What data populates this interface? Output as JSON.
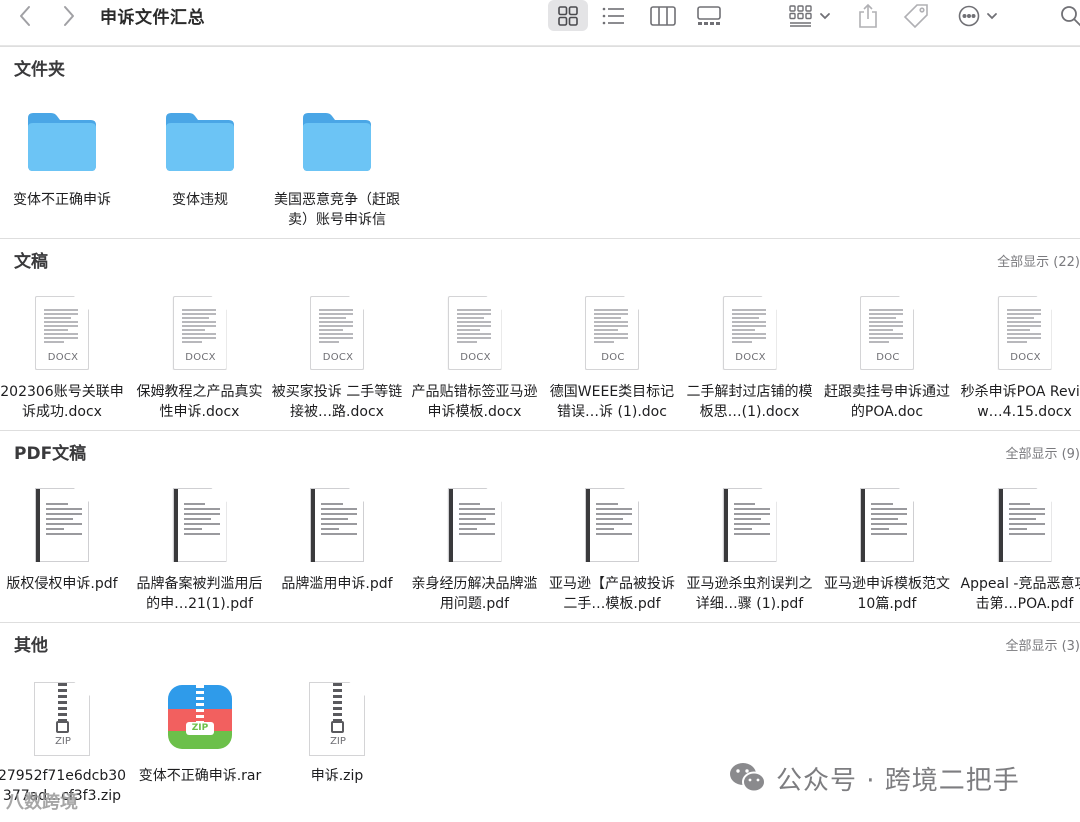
{
  "toolbar": {
    "title": "申诉文件汇总",
    "icons": [
      "chevron-left",
      "chevron-right",
      "grid-view",
      "list-view",
      "column-view",
      "gallery-view",
      "group-by",
      "share",
      "tag",
      "more",
      "search"
    ]
  },
  "sections": {
    "folders": {
      "title": "文件夹",
      "items": [
        {
          "name": "变体不正确申诉"
        },
        {
          "name": "变体违规"
        },
        {
          "name": "美国恶意竞争（赶跟卖）账号申诉信"
        }
      ]
    },
    "documents": {
      "title": "文稿",
      "show_all": "全部显示 (22)",
      "items": [
        {
          "name": "202306账号关联申诉成功.docx",
          "type": "DOCX"
        },
        {
          "name": "保姆教程之产品真实性申诉.docx",
          "type": "DOCX"
        },
        {
          "name": "被买家投诉 二手等链接被…路.docx",
          "type": "DOCX"
        },
        {
          "name": "产品贴错标签亚马逊申诉模板.docx",
          "type": "DOCX"
        },
        {
          "name": "德国WEEE类目标记错误…诉 (1).doc",
          "type": "DOC"
        },
        {
          "name": "二手解封过店铺的模板思…(1).docx",
          "type": "DOCX"
        },
        {
          "name": "赶跟卖挂号申诉通过的POA.doc",
          "type": "DOC"
        },
        {
          "name": "秒杀申诉POA Review…4.15.docx",
          "type": "DOCX"
        }
      ]
    },
    "pdfs": {
      "title": "PDF文稿",
      "show_all": "全部显示 (9)",
      "items": [
        {
          "name": "版权侵权申诉.pdf"
        },
        {
          "name": "品牌备案被判滥用后的申…21(1).pdf"
        },
        {
          "name": "品牌滥用申诉.pdf"
        },
        {
          "name": "亲身经历解决品牌滥用问题.pdf"
        },
        {
          "name": "亚马逊【产品被投诉二手…模板.pdf"
        },
        {
          "name": "亚马逊杀虫剂误判之详细…骤 (1).pdf"
        },
        {
          "name": "亚马逊申诉模板范文10篇.pdf"
        },
        {
          "name": "Appeal -竞品恶意攻击第…POA.pdf"
        }
      ]
    },
    "others": {
      "title": "其他",
      "show_all": "全部显示 (3)",
      "items": [
        {
          "name": "27952f71e6dcb30377ad…cf3f3.zip",
          "type": "ZIP"
        },
        {
          "name": "变体不正确申诉.rar",
          "type": "ZIP"
        },
        {
          "name": "申诉.zip",
          "type": "ZIP"
        }
      ]
    }
  },
  "watermark": {
    "text": "公众号 · 跨境二把手",
    "corner": "八数跨境"
  },
  "colors": {
    "folder": "#5ab8f0",
    "accent": "#2f9bea"
  }
}
